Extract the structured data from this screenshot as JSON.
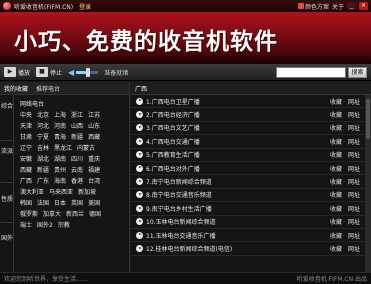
{
  "titlebar": {
    "title": "听爱收音机(FIFM.CN)",
    "login": "登录",
    "skin": "颜色方案",
    "about": "关于",
    "min": "_",
    "close": "×"
  },
  "banner": {
    "slogan": "小巧、免费的收音机软件"
  },
  "toolbar": {
    "play": "播放",
    "stop": "停止",
    "status": "准备就绪",
    "search_value": "",
    "search_button": "搜索",
    "volume_level": 0.55
  },
  "sidebar": {
    "tabs": [
      "我的收藏",
      "推荐电台"
    ],
    "categories": [
      "综合",
      "流派",
      "性质",
      "国外"
    ],
    "provinces": [
      [
        "网络电台"
      ],
      [
        "中央",
        "北京",
        "上海",
        "浙江",
        "江苏"
      ],
      [
        "天津",
        "河北",
        "河南",
        "山西",
        "山东"
      ],
      [
        "甘肃",
        "宁夏",
        "青海",
        "新疆",
        "西藏"
      ],
      [
        "辽宁",
        "吉林",
        "黑龙江",
        "内蒙古"
      ],
      [
        "安徽",
        "湖北",
        "湖南",
        "四川",
        "重庆"
      ],
      [
        "西藏",
        "新疆",
        "贵州",
        "云南",
        "福建"
      ],
      [
        "广西",
        "广东",
        "海南",
        "香港",
        "台湾"
      ],
      [
        "澳大利亚",
        "马来西亚",
        "新加坡"
      ],
      [
        "韩国",
        "法国",
        "日本",
        "英国",
        "美国"
      ],
      [
        "俄罗斯",
        "加拿大",
        "新西兰",
        "德国"
      ],
      [
        "瑞士",
        "国外2",
        "宗教"
      ]
    ]
  },
  "main": {
    "header": "广西",
    "fav_label": "收藏",
    "site_label": "网址",
    "stations": [
      "1.广西电台卫星广播",
      "2.广西电台经济广播",
      "3.广西电台文艺广播",
      "4.广西电台交通广播",
      "5.广西教育生活广播",
      "6.广西电台对外广播",
      "7.南宁电台新闻综合频道",
      "8.南宁电台交通音乐频道",
      "9.南宁电台乡村生活广播",
      "10.玉林电台新闻综合频道",
      "11.玉林电台交通音乐广播",
      "12.桂林电台新闻综合频道(电信)"
    ]
  },
  "statusbar": {
    "left": "欢迎您到听世界，享受生活……",
    "right": "听爱收音机 FIFM.CN 出品"
  }
}
